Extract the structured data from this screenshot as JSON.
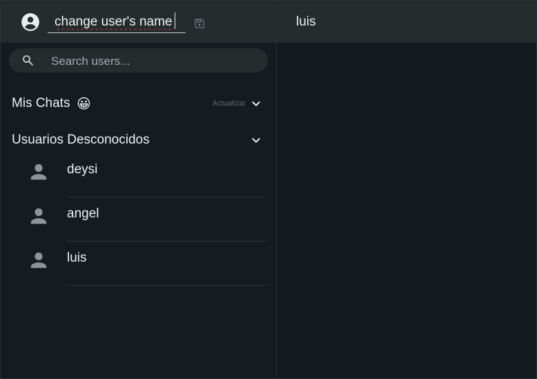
{
  "profile": {
    "name_value": "change user's name"
  },
  "search": {
    "placeholder": "Search users..."
  },
  "sections": {
    "my_chats": {
      "title": "Mis Chats",
      "emoji": "😀",
      "refresh_label": "Actualizar"
    },
    "unknown_users": {
      "title": "Usuarios Desconocidos",
      "users": [
        {
          "name": "deysi"
        },
        {
          "name": "angel"
        },
        {
          "name": "luis"
        }
      ]
    }
  },
  "chat": {
    "title": "luis"
  },
  "colors": {
    "header_bg": "#262b2e",
    "panel_bg": "#151b20",
    "icon_gray": "#8a949a",
    "accent_text": "#eef1f2"
  }
}
